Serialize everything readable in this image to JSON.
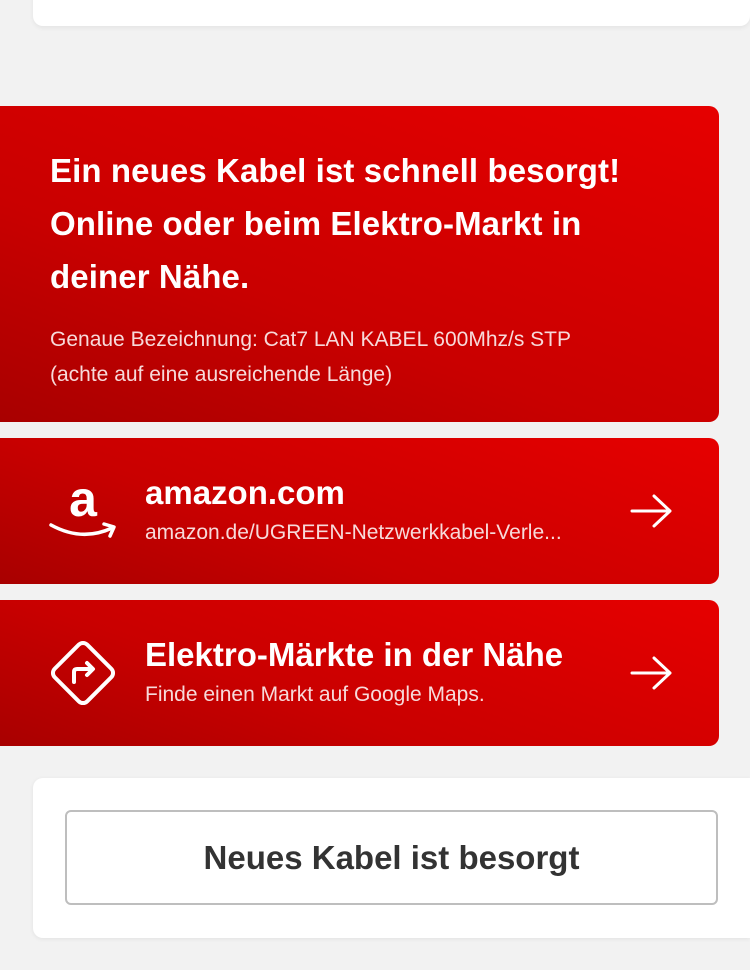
{
  "info_card": {
    "title": "Ein neues Kabel ist schnell besorgt! Online oder beim Elektro-Markt in deiner Nähe.",
    "subtitle_line1": "Genaue Bezeichnung: Cat7 LAN KABEL 600Mhz/s STP",
    "subtitle_line2": "(achte auf eine ausreichende Länge)"
  },
  "links": [
    {
      "title": "amazon.com",
      "subtitle": "amazon.de/UGREEN-Netzwerkkabel-Verle...",
      "icon": "amazon-logo-icon"
    },
    {
      "title": "Elektro-Märkte in der Nähe",
      "subtitle": "Finde einen Markt auf Google Maps.",
      "icon": "directions-icon"
    }
  ],
  "bottom_button": {
    "label": "Neues Kabel ist besorgt"
  },
  "colors": {
    "brand_red": "#e60000",
    "brand_red_dark": "#a80000",
    "background": "#f2f2f2",
    "button_text": "#333333",
    "button_border": "#bebebe"
  }
}
